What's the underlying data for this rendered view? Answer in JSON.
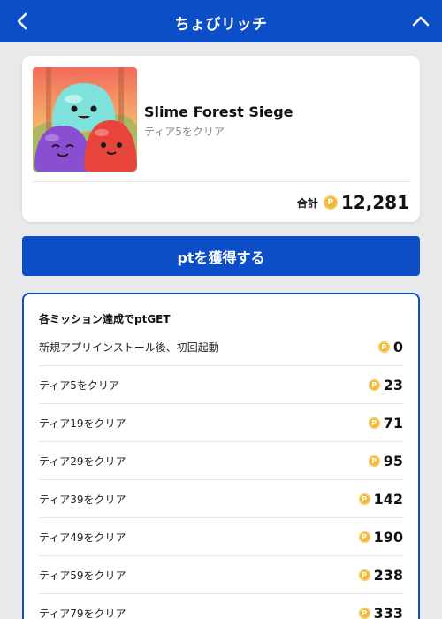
{
  "header": {
    "title": "ちょびリッチ",
    "back_icon": "chevron-left-icon",
    "collapse_icon": "chevron-up-icon"
  },
  "game": {
    "name": "Slime Forest Siege",
    "subtitle": "ティア5をクリア",
    "thumbnail": "slime-characters-image"
  },
  "total": {
    "label": "合計",
    "coin_symbol": "P",
    "value": "12,281"
  },
  "cta": {
    "label": "ptを獲得する"
  },
  "missions": {
    "title": "各ミッション達成でptGET",
    "items": [
      {
        "label": "新規アプリインストール後、初回起動",
        "points": "0"
      },
      {
        "label": "ティア5をクリア",
        "points": "23"
      },
      {
        "label": "ティア19をクリア",
        "points": "71"
      },
      {
        "label": "ティア29をクリア",
        "points": "95"
      },
      {
        "label": "ティア39をクリア",
        "points": "142"
      },
      {
        "label": "ティア49をクリア",
        "points": "190"
      },
      {
        "label": "ティア59をクリア",
        "points": "238"
      },
      {
        "label": "ティア79をクリア",
        "points": "333"
      }
    ]
  },
  "colors": {
    "brand_blue": "#0b4ec8",
    "coin_gold": "#f2b73a",
    "background": "#e9e9ec"
  }
}
